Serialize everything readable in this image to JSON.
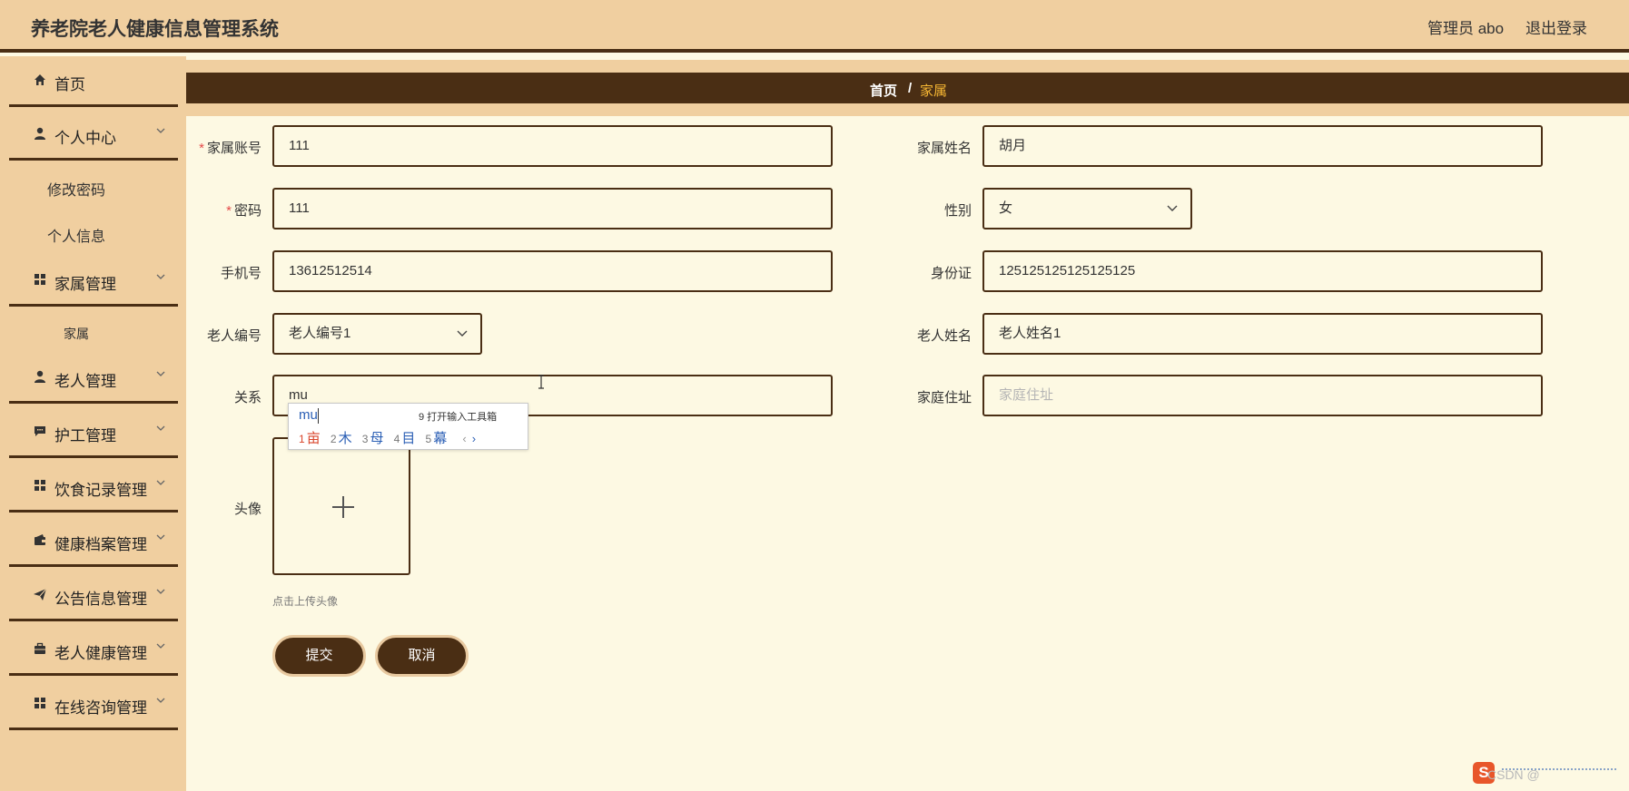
{
  "header": {
    "title": "养老院老人健康信息管理系统",
    "admin": "管理员 abo",
    "logout": "退出登录"
  },
  "sidebar": {
    "items": [
      {
        "label": "首页",
        "icon": "home-icon"
      },
      {
        "label": "个人中心",
        "icon": "user-icon"
      },
      {
        "label": "家属管理",
        "icon": "grid-icon"
      },
      {
        "label": "老人管理",
        "icon": "user-icon"
      },
      {
        "label": "护工管理",
        "icon": "chat-icon"
      },
      {
        "label": "饮食记录管理",
        "icon": "grid-icon"
      },
      {
        "label": "健康档案管理",
        "icon": "wallet-icon"
      },
      {
        "label": "公告信息管理",
        "icon": "send-icon"
      },
      {
        "label": "老人健康管理",
        "icon": "briefcase-icon"
      },
      {
        "label": "在线咨询管理",
        "icon": "grid-icon"
      }
    ],
    "sub_personal": [
      "修改密码",
      "个人信息"
    ],
    "sub_family": [
      "家属"
    ]
  },
  "breadcrumb": {
    "home": "首页",
    "separator": "/",
    "current": "家属"
  },
  "form": {
    "account": {
      "label": "家属账号",
      "value": "111",
      "required": "*"
    },
    "name": {
      "label": "家属姓名",
      "value": "胡月"
    },
    "password": {
      "label": "密码",
      "value": "111",
      "required": "*"
    },
    "gender": {
      "label": "性别",
      "value": "女"
    },
    "phone": {
      "label": "手机号",
      "value": "13612512514"
    },
    "idcard": {
      "label": "身份证",
      "value": "125125125125125125"
    },
    "elder_no": {
      "label": "老人编号",
      "value": "老人编号1"
    },
    "elder_name": {
      "label": "老人姓名",
      "value": "老人姓名1"
    },
    "relation": {
      "label": "关系",
      "value": "mu"
    },
    "address": {
      "label": "家庭住址",
      "placeholder": "家庭住址"
    },
    "avatar": {
      "label": "头像",
      "tip": "点击上传头像"
    }
  },
  "buttons": {
    "submit": "提交",
    "cancel": "取消"
  },
  "ime": {
    "composition": "mu",
    "toolbox_hint": "9 打开输入工具箱",
    "candidates": [
      {
        "n": "1",
        "c": "亩"
      },
      {
        "n": "2",
        "c": "木"
      },
      {
        "n": "3",
        "c": "母"
      },
      {
        "n": "4",
        "c": "目"
      },
      {
        "n": "5",
        "c": "幕"
      }
    ],
    "prev": "‹",
    "next": "›"
  },
  "corner": {
    "logo": "S",
    "watermark": "CSDN @"
  },
  "colors": {
    "header_bg": "#f0cfa0",
    "dark_brown": "#4a2e14",
    "page_bg": "#fdf9e3",
    "crumb_current": "#f7b733"
  }
}
